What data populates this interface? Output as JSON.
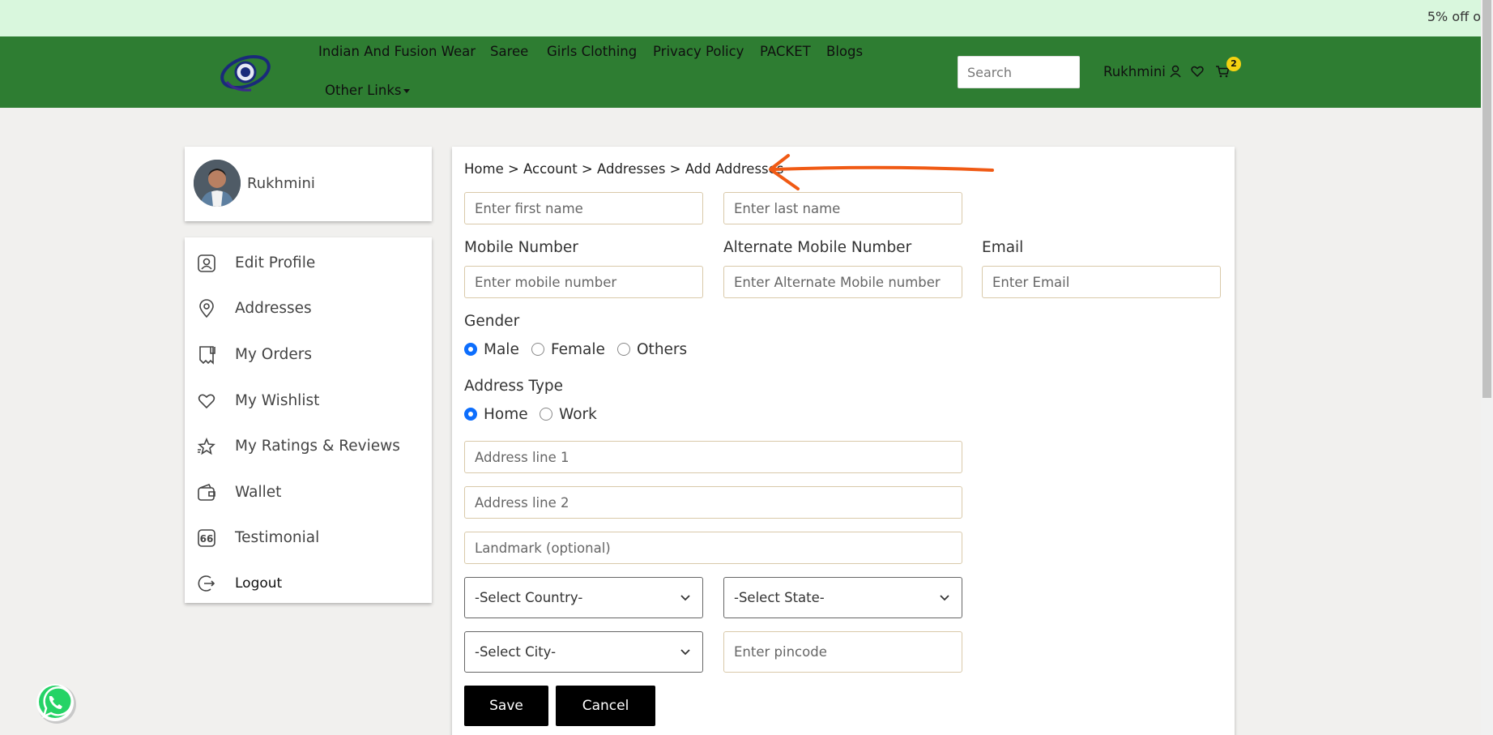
{
  "promo": {
    "text": "5% off o"
  },
  "nav": {
    "links": [
      "Indian And Fusion Wear",
      "Saree",
      "Girls Clothing",
      "Privacy Policy",
      "PACKET",
      "Blogs"
    ],
    "other_links": "Other Links",
    "search_placeholder": "Search",
    "user_name": "Rukhmini",
    "cart_count": "2",
    "bg_color": "#2e7d32",
    "promo_bg": "#d9f7dd",
    "icons": [
      "logo-icon",
      "user-icon",
      "heart-icon",
      "cart-icon"
    ]
  },
  "sidebar": {
    "profile_name": "Rukhmini",
    "items": [
      {
        "label": "Edit Profile",
        "icon": "user-card-icon"
      },
      {
        "label": "Addresses",
        "icon": "location-pin-icon"
      },
      {
        "label": "My Orders",
        "icon": "receipt-icon"
      },
      {
        "label": "My Wishlist",
        "icon": "heart-icon"
      },
      {
        "label": "My Ratings & Reviews",
        "icon": "star-review-icon"
      },
      {
        "label": "Wallet",
        "icon": "wallet-icon"
      },
      {
        "label": "Testimonial",
        "icon": "quote-icon"
      },
      {
        "label": "Logout",
        "icon": "logout-icon"
      }
    ]
  },
  "form": {
    "breadcrumb": "Home > Account > Addresses > Add Addresses",
    "first_name_placeholder": "Enter first name",
    "last_name_placeholder": "Enter last name",
    "mobile_label": "Mobile Number",
    "mobile_placeholder": "Enter mobile number",
    "alt_mobile_label": "Alternate Mobile Number",
    "alt_mobile_placeholder": "Enter Alternate Mobile number",
    "email_label": "Email",
    "email_placeholder": "Enter Email",
    "gender_label": "Gender",
    "gender_options": [
      "Male",
      "Female",
      "Others"
    ],
    "gender_selected": "Male",
    "address_type_label": "Address Type",
    "address_type_options": [
      "Home",
      "Work"
    ],
    "address_type_selected": "Home",
    "address1_placeholder": "Address line 1",
    "address2_placeholder": "Address line 2",
    "landmark_placeholder": "Landmark (optional)",
    "country_value": "-Select Country-",
    "state_value": "-Select State-",
    "city_value": "-Select City-",
    "pincode_placeholder": "Enter pincode",
    "save_label": "Save",
    "cancel_label": "Cancel",
    "radio_color": "#0d6efd",
    "annotation_color": "#f05a14"
  }
}
